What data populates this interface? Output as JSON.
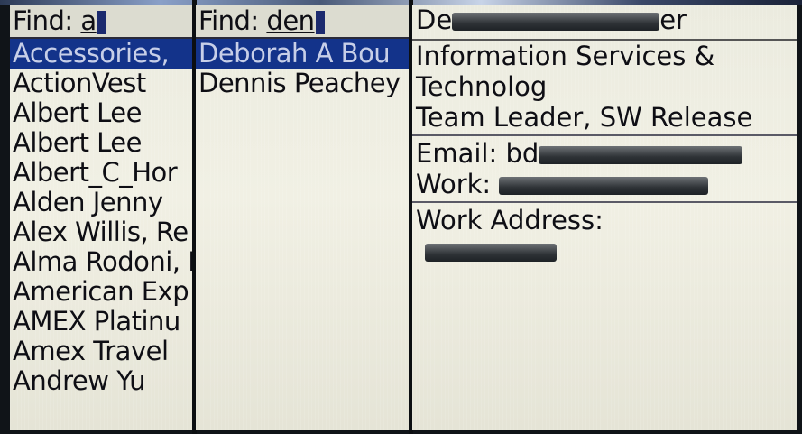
{
  "list_panel": {
    "search": {
      "prefix": "Find:",
      "term": "a"
    },
    "items": [
      {
        "label": "Accessories,"
      },
      {
        "label": "ActionVest"
      },
      {
        "label": "Albert Lee"
      },
      {
        "label": "Albert Lee"
      },
      {
        "label": "Albert_C_Hor"
      },
      {
        "label": "Alden Jenny"
      },
      {
        "label": "Alex Willis, Re"
      },
      {
        "label": "Alma Rodoni, I"
      },
      {
        "label": "American Exp"
      },
      {
        "label": "AMEX Platinu"
      },
      {
        "label": "Amex Travel"
      },
      {
        "label": "Andrew Yu"
      }
    ],
    "selected_index": 0
  },
  "filtered_panel": {
    "search": {
      "prefix": "Find:",
      "term": "den"
    },
    "items": [
      {
        "label": "Deborah A Bou"
      },
      {
        "label": "Dennis Peachey"
      }
    ],
    "selected_index": 0
  },
  "detail_panel": {
    "name_prefix": "De",
    "name_suffix": "er",
    "department_line1": "Information Services &",
    "department_line2": "Technolog",
    "title": "Team Leader, SW Release",
    "email_label": "Email: bd",
    "work_label": "Work:",
    "address_label": "Work Address:"
  },
  "colors": {
    "selection_bg": "#13338a",
    "selection_text": "#c7cfe8",
    "screen_bg": "#ebebdf",
    "text": "#0e0e14"
  }
}
